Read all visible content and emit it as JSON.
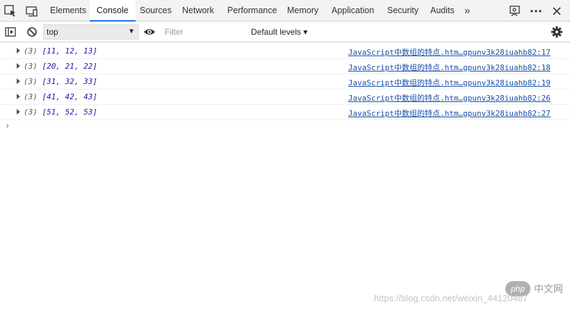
{
  "tabbar": {
    "icons": [
      "inspect-element-icon",
      "device-toggle-icon"
    ],
    "tabs": [
      {
        "label": "Elements"
      },
      {
        "label": "Console"
      },
      {
        "label": "Sources"
      },
      {
        "label": "Network"
      },
      {
        "label": "Performance"
      },
      {
        "label": "Memory"
      },
      {
        "label": "Application"
      },
      {
        "label": "Security"
      },
      {
        "label": "Audits"
      }
    ],
    "active_tab": "Console",
    "more_tabs_glyph": "»",
    "right_icons": [
      "feedback-icon",
      "more-options-icon",
      "close-icon"
    ]
  },
  "toolbar": {
    "context_value": "top",
    "filter_placeholder": "Filter",
    "levels_label": "Default levels ▾"
  },
  "console": {
    "entries": [
      {
        "count": "(3)",
        "value": "[11, 12, 13]",
        "source": "JavaScript中数组的特点.htm…gpunv3k28iuahb82:17"
      },
      {
        "count": "(3)",
        "value": "[20, 21, 22]",
        "source": "JavaScript中数组的特点.htm…gpunv3k28iuahb82:18"
      },
      {
        "count": "(3)",
        "value": "[31, 32, 33]",
        "source": "JavaScript中数组的特点.htm…gpunv3k28iuahb82:19"
      },
      {
        "count": "(3)",
        "value": "[41, 42, 43]",
        "source": "JavaScript中数组的特点.htm…gpunv3k28iuahb82:26"
      },
      {
        "count": "(3)",
        "value": "[51, 52, 53]",
        "source": "JavaScript中数组的特点.htm…gpunv3k28iuahb82:27"
      }
    ],
    "prompt_glyph": "›"
  },
  "watermark": {
    "logo_text": "php",
    "site_name": "中文网",
    "url": "https://blog.csdn.net/weixin_44120487"
  }
}
